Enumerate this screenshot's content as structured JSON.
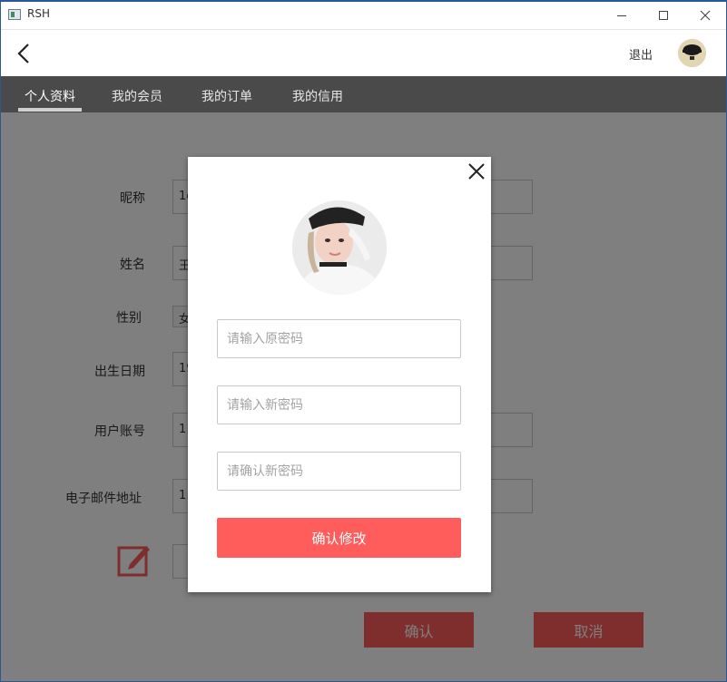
{
  "window": {
    "title": "RSH"
  },
  "header": {
    "logout_label": "退出"
  },
  "tabs": [
    {
      "label": "个人资料"
    },
    {
      "label": "我的会员"
    },
    {
      "label": "我的订单"
    },
    {
      "label": "我的信用"
    }
  ],
  "form": {
    "nickname_label": "昵称",
    "nickname_value": "1c",
    "name_label": "姓名",
    "name_value": "王",
    "gender_label": "性别",
    "gender_value": "女",
    "birthday_label": "出生日期",
    "birthday_value": "19",
    "account_label": "用户账号",
    "account_value": "1",
    "email_label": "电子邮件地址",
    "email_value": "1",
    "confirm_label": "确认",
    "cancel_label": "取消"
  },
  "modal": {
    "old_password_placeholder": "请输入原密码",
    "new_password_placeholder": "请输入新密码",
    "confirm_password_placeholder": "请确认新密码",
    "submit_label": "确认修改"
  },
  "colors": {
    "accent": "#ff5c5c",
    "tabbar": "#4a4a4a",
    "overlay": "rgba(0,0,0,0.5)"
  },
  "icons": {
    "back": "chevron-left-icon",
    "close": "close-icon",
    "edit": "edit-icon",
    "minimize": "minimize-icon",
    "maximize": "maximize-icon",
    "window_close": "window-close-icon"
  }
}
